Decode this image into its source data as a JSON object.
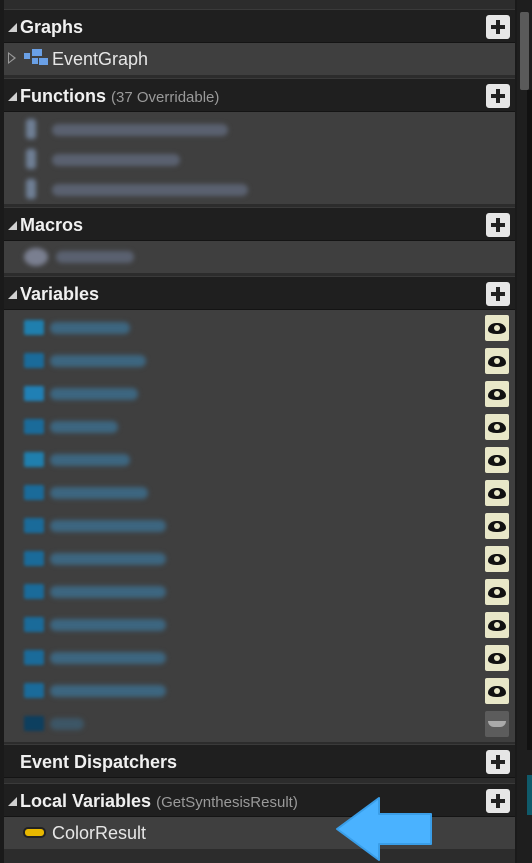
{
  "graphs": {
    "title": "Graphs",
    "items": [
      {
        "label": "EventGraph"
      }
    ]
  },
  "functions": {
    "title": "Functions",
    "subtitle": "(37 Overridable)"
  },
  "macros": {
    "title": "Macros"
  },
  "variables": {
    "title": "Variables",
    "visibility_icon": "eye-icon"
  },
  "event_dispatchers": {
    "title": "Event Dispatchers"
  },
  "local_variables": {
    "title": "Local Variables",
    "subtitle": "(GetSynthesisResult)",
    "items": [
      {
        "label": "ColorResult",
        "type_color": "#e8b800"
      }
    ]
  },
  "colors": {
    "header_bg": "#1f1f1f",
    "body_bg": "#3f3f3f",
    "eye_bg": "#e8e7c8",
    "arrow": "#4ab2ff"
  }
}
